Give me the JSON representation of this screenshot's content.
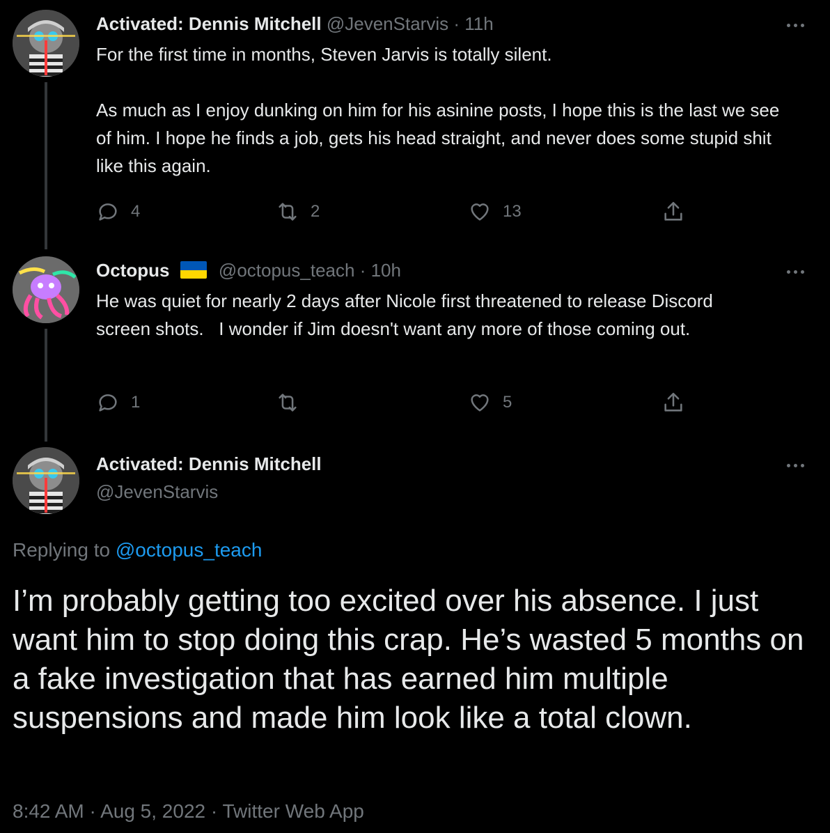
{
  "tweets": [
    {
      "name": "Activated: Dennis Mitchell",
      "handle": "@JevenStarvis",
      "sep": "·",
      "time": "11h",
      "text": "For the first time in months, Steven Jarvis is totally silent.\n\nAs much as I enjoy dunking on him for his asinine posts, I hope this is the last we see of him. I hope he finds a job, gets his head straight, and never does some stupid shit like this again.",
      "replies": "4",
      "retweets": "2",
      "likes": "13"
    },
    {
      "name": "Octopus",
      "handle": "@octopus_teach",
      "sep": "·",
      "time": "10h",
      "text": "He was quiet for nearly 2 days after Nicole first threatened to release Discord screen shots.   I wonder if Jim doesn't want any more of those coming out.",
      "replies": "1",
      "retweets": "",
      "likes": "5"
    }
  ],
  "main": {
    "name": "Activated: Dennis Mitchell",
    "handle": "@JevenStarvis",
    "replying_prefix": "Replying to ",
    "replying_to": "@octopus_teach",
    "text": "I’m probably getting too excited over his absence. I just want him to stop doing this crap. He’s wasted 5 months on a fake investigation that has earned him multiple suspensions and made him look like a total clown.",
    "time": "8:42 AM",
    "date": "Aug 5, 2022",
    "source": "Twitter Web App",
    "sep": "·"
  },
  "icons": {
    "reply": "reply-icon",
    "retweet": "retweet-icon",
    "like": "heart-icon",
    "share": "share-icon",
    "more": "more-icon",
    "flag": "ukraine-flag-icon"
  },
  "colors": {
    "background": "#000000",
    "text": "#e7e9ea",
    "muted": "#71767b",
    "link": "#1d9bf0"
  }
}
